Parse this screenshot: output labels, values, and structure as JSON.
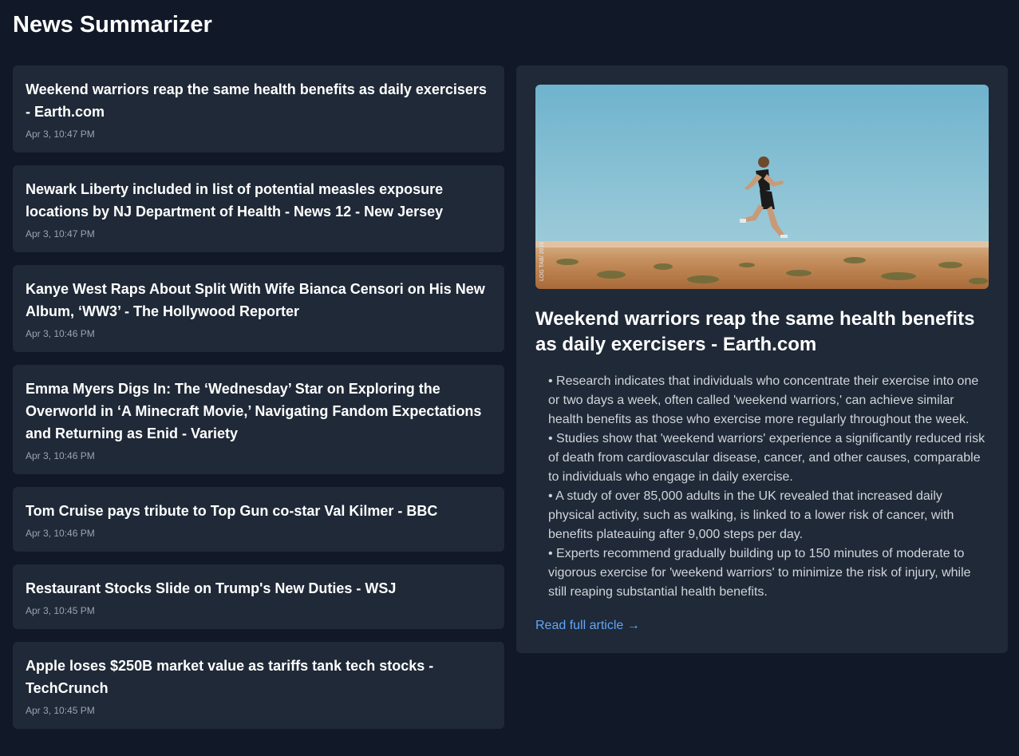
{
  "app": {
    "title": "News Summarizer"
  },
  "articles": [
    {
      "headline": "Weekend warriors reap the same health benefits as daily exercisers - Earth.com",
      "time": "Apr 3, 10:47 PM"
    },
    {
      "headline": "Newark Liberty included in list of potential measles exposure locations by NJ Department of Health - News 12 - New Jersey",
      "time": "Apr 3, 10:47 PM"
    },
    {
      "headline": "Kanye West Raps About Split With Wife Bianca Censori on His New Album, ‘WW3’ - The Hollywood Reporter",
      "time": "Apr 3, 10:46 PM"
    },
    {
      "headline": "Emma Myers Digs In: The ‘Wednesday’ Star on Exploring the Overworld in ‘A Minecraft Movie,’ Navigating Fandom Expectations and Returning as Enid - Variety",
      "time": "Apr 3, 10:46 PM"
    },
    {
      "headline": "Tom Cruise pays tribute to Top Gun co-star Val Kilmer - BBC",
      "time": "Apr 3, 10:46 PM"
    },
    {
      "headline": "Restaurant Stocks Slide on Trump's New Duties - WSJ",
      "time": "Apr 3, 10:45 PM"
    },
    {
      "headline": "Apple loses $250B market value as tariffs tank tech stocks - TechCrunch",
      "time": "Apr 3, 10:45 PM"
    }
  ],
  "detail": {
    "title": "Weekend warriors reap the same health benefits as daily exercisers - Earth.com",
    "summary": [
      "• Research indicates that individuals who concentrate their exercise into one or two days a week, often called 'weekend warriors,' can achieve similar health benefits as those who exercise more regularly throughout the week.",
      "• Studies show that 'weekend warriors' experience a significantly reduced risk of death from cardiovascular disease, cancer, and other causes, comparable to individuals who engage in daily exercise.",
      "• A study of over 85,000 adults in the UK revealed that increased daily physical activity, such as walking, is linked to a lower risk of cancer, with benefits plateauing after 9,000 steps per day.",
      "• Experts recommend gradually building up to 150 minutes of moderate to vigorous exercise for 'weekend warriors' to minimize the risk of injury, while still reaping substantial health benefits."
    ],
    "link_label": "Read full article →",
    "image_watermark": "LOG TAB/ 2016"
  },
  "colors": {
    "background": "#111827",
    "card": "#1f2937",
    "muted_text": "#9ca3af",
    "body_text": "#d1d5db",
    "link": "#60a5fa"
  }
}
